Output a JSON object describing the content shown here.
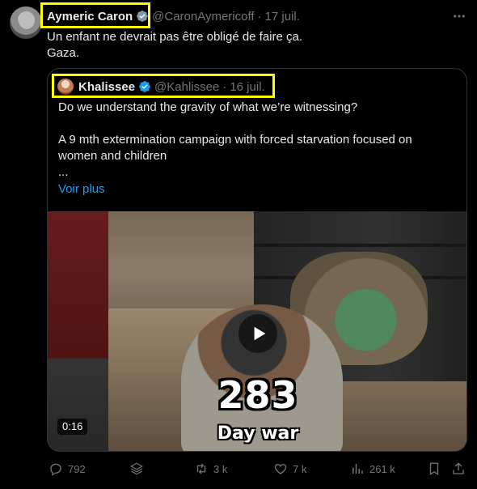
{
  "author": {
    "name": "Aymeric Caron",
    "handle": "@CaronAymericoff",
    "separator": "·",
    "date": "17 juil."
  },
  "tweet": {
    "line1": "Un enfant ne devrait pas être obligé de faire ça.",
    "line2": "Gaza."
  },
  "quote": {
    "name": "Khalissee",
    "handle": "@Kahlissee",
    "separator": "·",
    "date": "16 juil.",
    "line1": "Do we understand the gravity of what we’re witnessing?",
    "line2": "A 9 mth extermination campaign with forced starvation focused on",
    "line3": "women and children",
    "ellipsis": "...",
    "more": "Voir plus",
    "video": {
      "overlay_number": "283",
      "overlay_sub": "Day war",
      "duration": "0:16"
    }
  },
  "actions": {
    "replies": "792",
    "retweets": "3 k",
    "likes": "7 k",
    "views": "261 k"
  },
  "colors": {
    "background": "#000000",
    "text": "#e7e9ea",
    "muted": "#71767b",
    "link": "#1d9bf0",
    "verified": "#1d9bf0",
    "highlight": "#ffff00"
  }
}
